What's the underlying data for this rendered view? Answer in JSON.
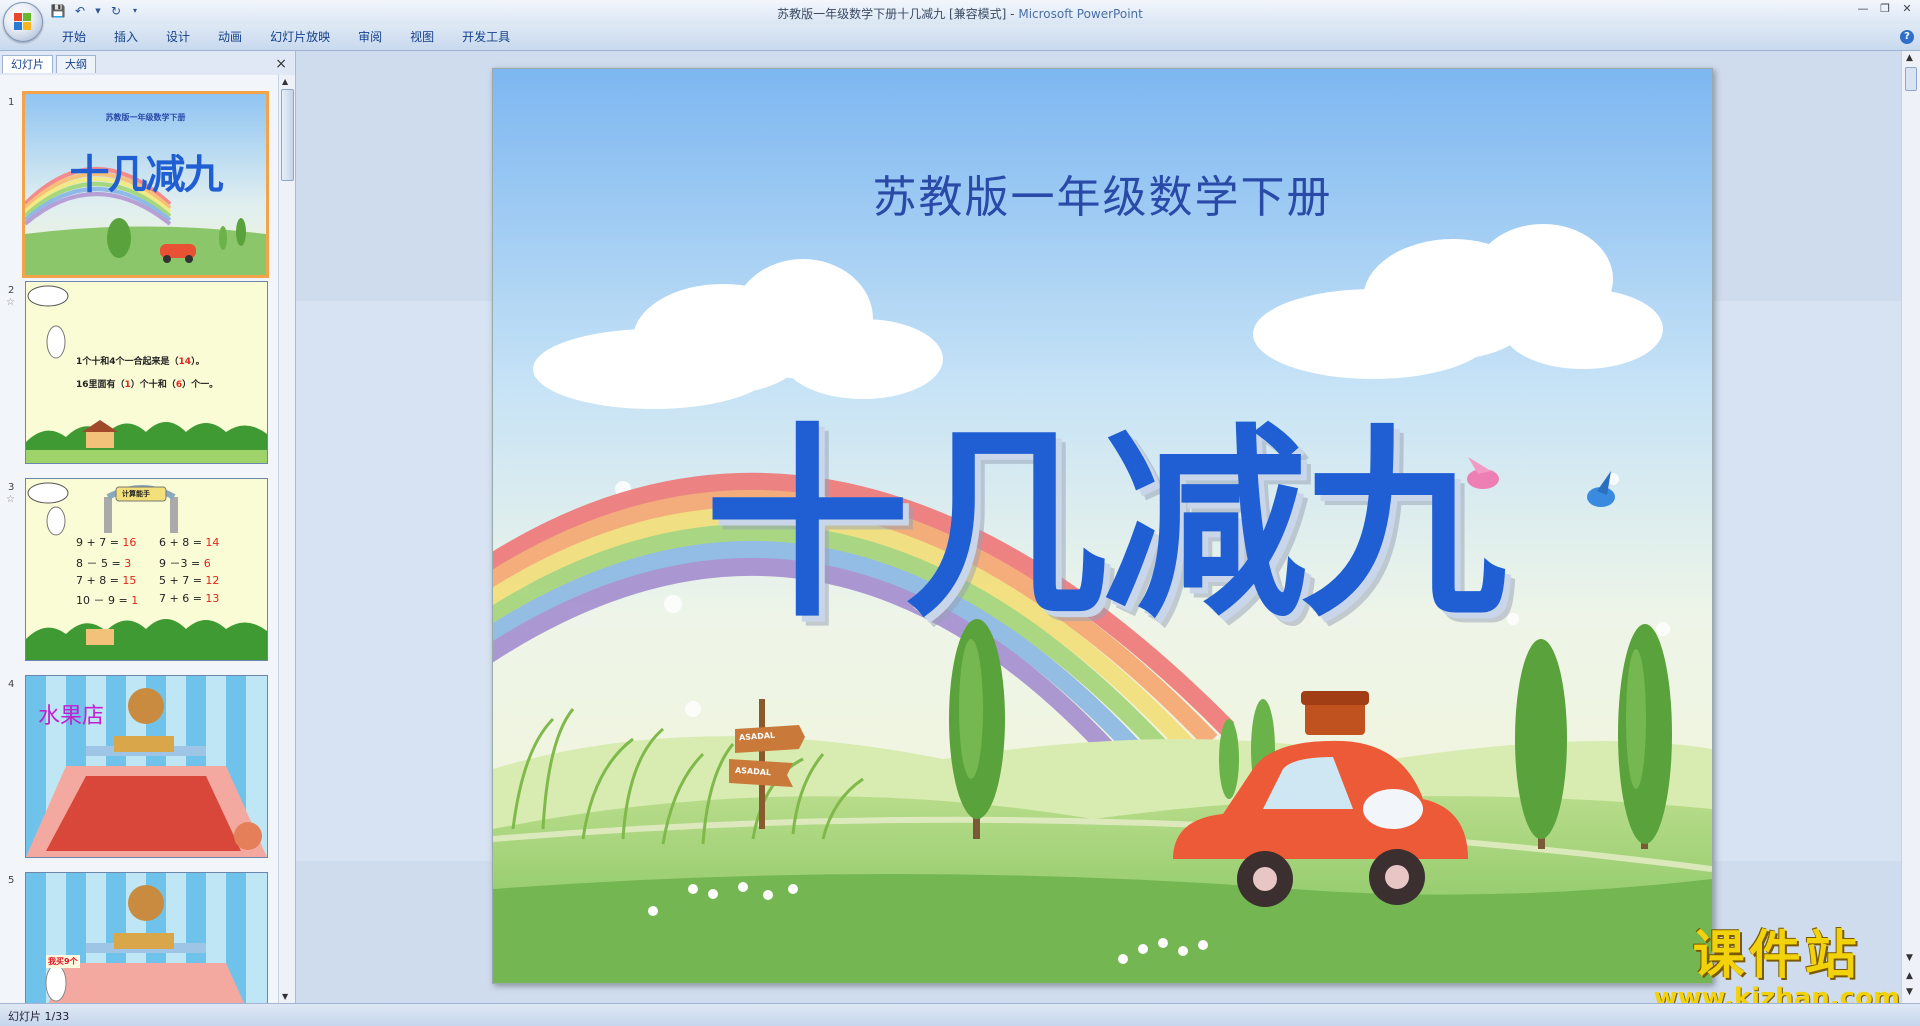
{
  "window": {
    "title": "苏教版一年级数学下册十几减九 [兼容模式]",
    "app_name": "Microsoft PowerPoint",
    "separator": "-"
  },
  "ribbon": {
    "tabs": [
      "开始",
      "插入",
      "设计",
      "动画",
      "幻灯片放映",
      "审阅",
      "视图",
      "开发工具"
    ]
  },
  "panel": {
    "tabs": [
      "幻灯片",
      "大纲"
    ],
    "close": "×"
  },
  "thumbnails": [
    {
      "num": "1",
      "subtitle": "苏教版一年级数学下册",
      "title": "十几减九"
    },
    {
      "num": "2",
      "line1_prefix": "1个十和4个一合起来是（",
      "line1_value": "14",
      "line1_suffix": "）。",
      "line2_prefix": "16里面有（",
      "line2_value1": "1",
      "line2_mid": "）个十和（",
      "line2_value2": "6",
      "line2_suffix": "）个一。"
    },
    {
      "num": "3",
      "banner": "计算能手",
      "equations": [
        {
          "expr": "9 + 7 =",
          "ans": "16"
        },
        {
          "expr": "6 + 8 =",
          "ans": "14"
        },
        {
          "expr": "8 － 5 =",
          "ans": "3"
        },
        {
          "expr": "9 －3 =",
          "ans": "6"
        },
        {
          "expr": "7 + 8 =",
          "ans": "15"
        },
        {
          "expr": "5 + 7 =",
          "ans": "12"
        },
        {
          "expr": "10 － 9 =",
          "ans": "1"
        },
        {
          "expr": "7 + 6 =",
          "ans": "13"
        }
      ]
    },
    {
      "num": "4",
      "shop_sign": "水果店"
    },
    {
      "num": "5",
      "speech": "我买9个"
    }
  ],
  "slide": {
    "subtitle": "苏教版一年级数学下册",
    "title": "十几减九",
    "signpost": [
      "ASADAL",
      "ASADAL"
    ]
  },
  "status": {
    "slide_indicator": "幻灯片 1/33"
  },
  "watermark": {
    "line1": "课件站",
    "line2": "www.kjzhan.com"
  },
  "colors": {
    "accent": "#1f5ed3",
    "subtitle": "#2a4aa8",
    "selection": "#f3a349",
    "answer_red": "#e0241b"
  }
}
